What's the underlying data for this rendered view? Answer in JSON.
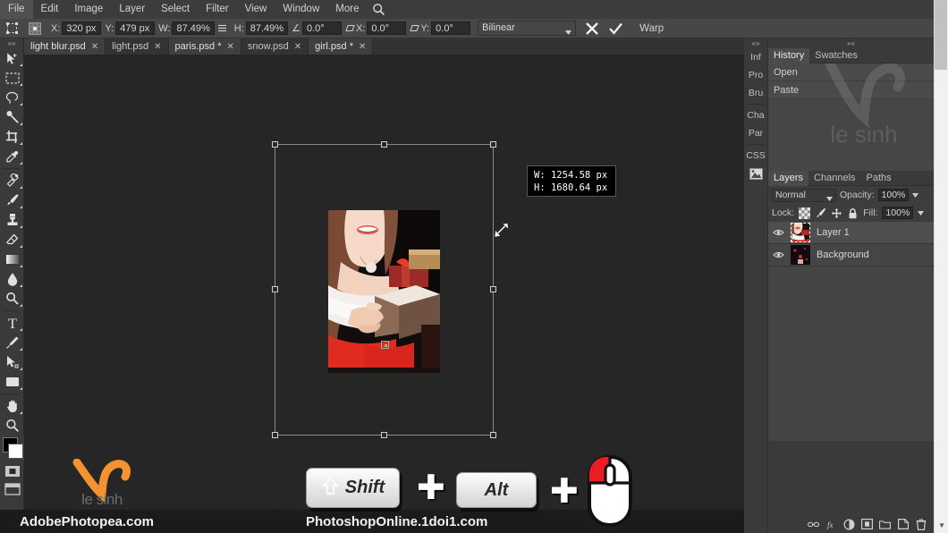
{
  "menu": {
    "items": [
      "File",
      "Edit",
      "Image",
      "Layer",
      "Select",
      "Filter",
      "View",
      "Window",
      "More"
    ],
    "search_icon": "search-icon"
  },
  "options_bar": {
    "tool_icon": "free-transform-icon",
    "reference_point_icon": "reference-point-icon",
    "x_label": "X:",
    "x_value": "320 px",
    "y_label": "Y:",
    "y_value": "479 px",
    "w_label": "W:",
    "w_value": "87.49%",
    "link_icon": "link-chain-icon",
    "h_label": "H:",
    "h_value": "87.49%",
    "angle_label": "∠",
    "angle_value": "0.0°",
    "skew_x_label": "X:",
    "skew_x_value": "0.0°",
    "skew_y_label": "Y:",
    "skew_y_value": "0.0°",
    "interpolation": "Bilinear",
    "cancel_icon": "cancel-x-icon",
    "commit_icon": "commit-check-icon",
    "warp_label": "Warp"
  },
  "tabs": [
    {
      "label": "light blur.psd",
      "close": "✕",
      "active": false
    },
    {
      "label": "light.psd",
      "close": "✕",
      "active": false
    },
    {
      "label": "paris.psd *",
      "close": "✕",
      "active": true
    },
    {
      "label": "snow.psd",
      "close": "✕",
      "active": false
    },
    {
      "label": "girl.psd *",
      "close": "✕",
      "active": true
    }
  ],
  "toolbar": {
    "tools": [
      "move-tool",
      "rectangular-marquee-tool",
      "lasso-tool",
      "magic-wand-tool",
      "crop-tool",
      "eyedropper-tool",
      "SEP",
      "healing-brush-tool",
      "brush-tool",
      "clone-stamp-tool",
      "eraser-tool",
      "gradient-tool",
      "blur-tool",
      "dodge-tool",
      "SEP",
      "type-tool",
      "pen-tool",
      "path-select-tool",
      "shape-tool",
      "SEP",
      "hand-tool",
      "zoom-tool"
    ],
    "foreground_color": "#000000",
    "background_color": "#ffffff",
    "quick_mask_icon": "quick-mask-icon",
    "screen_mode_icon": "screen-mode-icon"
  },
  "canvas": {
    "size_tooltip": {
      "w_label": "W:",
      "w_value": "1254.58 px",
      "h_label": "H:",
      "h_value": "1680.64 px"
    },
    "cursor_icon": "resize-diagonal-cursor-icon",
    "transform_box": "transform-selection-box",
    "background_color": "#262626"
  },
  "right_dock": {
    "vertical_tabs": [
      "Inf",
      "Pro",
      "Bru",
      "Cha",
      "Par",
      "CSS"
    ],
    "image_tab_icon": "image-panel-icon",
    "collapse_icon": "collapse-arrows-icon"
  },
  "history_panel": {
    "tabs": [
      {
        "label": "History",
        "active": true
      },
      {
        "label": "Swatches",
        "active": false
      }
    ],
    "entries": [
      "Open",
      "Paste"
    ],
    "watermark": "le sinh"
  },
  "layers_panel": {
    "tabs": [
      {
        "label": "Layers",
        "active": true
      },
      {
        "label": "Channels",
        "active": false
      },
      {
        "label": "Paths",
        "active": false
      }
    ],
    "blend_mode": "Normal",
    "opacity_label": "Opacity:",
    "opacity_value": "100%",
    "lock_label": "Lock:",
    "lock_icons": [
      "lock-transparency-icon",
      "lock-pixels-icon",
      "lock-position-icon",
      "lock-all-icon"
    ],
    "fill_label": "Fill:",
    "fill_value": "100%",
    "layers": [
      {
        "name": "Layer 1",
        "visible": true,
        "selected": true
      },
      {
        "name": "Background",
        "visible": true,
        "selected": false
      }
    ],
    "bottom_icons": [
      "link-layers-icon",
      "layer-style-icon",
      "adjustment-layer-icon",
      "layer-mask-icon",
      "new-group-icon",
      "new-layer-icon",
      "delete-layer-icon"
    ]
  },
  "overlay": {
    "logo_text": "le sinh",
    "bottom_left_banner": "AdobePhotopea.com",
    "bottom_center_banner": "PhotoshopOnline.1doi1.com",
    "keys": [
      {
        "label": "Shift",
        "icon": "shift-arrow-icon"
      },
      {
        "label": "Alt",
        "icon": null
      }
    ],
    "plus_symbol": "✚",
    "mouse_icon": "mouse-left-click-icon",
    "mouse_button_color": "#ed1c24"
  },
  "scrollbar": {
    "name": "page-vertical-scrollbar",
    "arrow": "▼"
  }
}
